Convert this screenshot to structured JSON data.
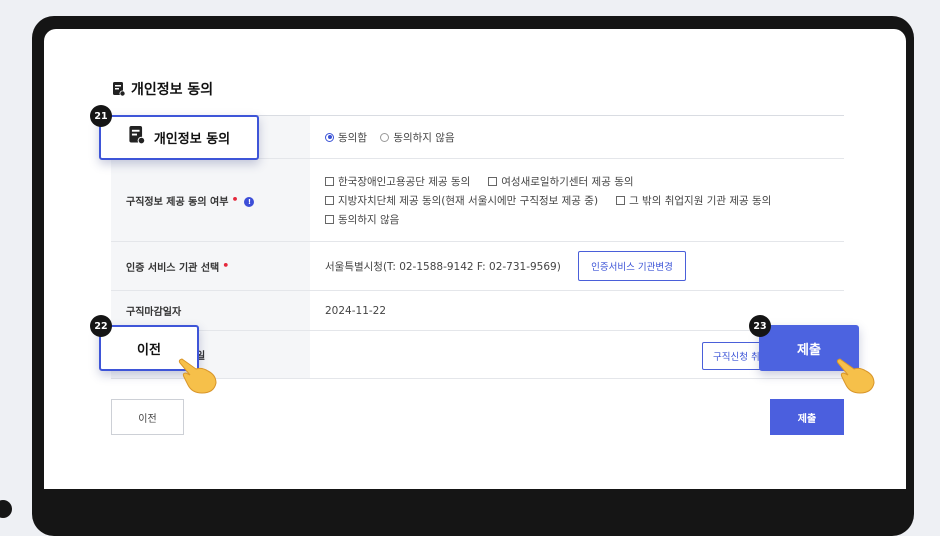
{
  "section": {
    "title": "개인정보 동의"
  },
  "rows": {
    "consent": {
      "options": [
        "동의함",
        "동의하지 않음"
      ],
      "selected": 0
    },
    "share": {
      "label": "구직정보 제공 동의 여부",
      "line1": [
        "한국장애인고용공단 제공 동의",
        "여성새로일하기센터 제공 동의"
      ],
      "line2": [
        "지방자치단체 제공 동의(현재 서울시에만 구직정보 제공 중)",
        "그 밖의 취업지원 기관 제공 동의"
      ],
      "line3": [
        "동의하지 않음"
      ]
    },
    "agency": {
      "label": "인증 서비스 기관 선택",
      "value": "서울특별시청(T: 02-1588-9142 F: 02-731-9569)",
      "button": "인증서비스 기관변경"
    },
    "deadline": {
      "label": "구직마감일자",
      "value": "2024-11-22"
    },
    "apply": {
      "label_tail": "일",
      "button": "구직신청 취"
    }
  },
  "buttons": {
    "prev": "이전",
    "submit": "제출"
  },
  "callouts": {
    "c21": {
      "num": "21",
      "label": "개인정보 동의"
    },
    "c22": {
      "num": "22",
      "label": "이전"
    },
    "c23": {
      "num": "23",
      "label": "제출"
    }
  },
  "colors": {
    "accent": "#4b5fde",
    "required": "#e5283c",
    "frame": "#151515"
  }
}
